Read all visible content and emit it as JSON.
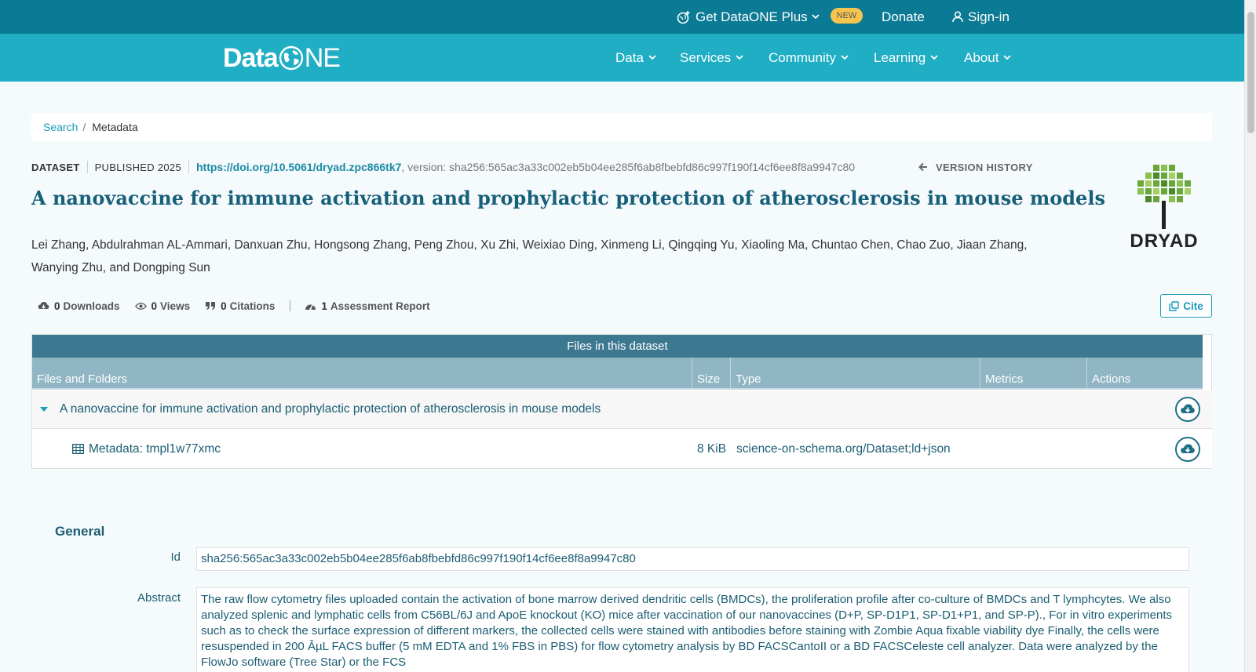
{
  "topbar": {
    "plus_label": "Get DataONE Plus",
    "new_badge": "NEW",
    "donate_label": "Donate",
    "signin_label": "Sign-in"
  },
  "navbar": {
    "logo_text_a": "Data",
    "logo_text_b": "NE",
    "items": [
      "Data",
      "Services",
      "Community",
      "Learning",
      "About"
    ]
  },
  "breadcrumb": {
    "search": "Search",
    "separator": "/",
    "current": "Metadata"
  },
  "dataset": {
    "type": "DATASET",
    "published": "PUBLISHED 2025",
    "doi": "https://doi.org/10.5061/dryad.zpc866tk7",
    "version": ", version: sha256:565ac3a33c002eb5b04ee285f6ab8fbebfd86c997f190f14cf6ee8f8a9947c80",
    "version_history": "VERSION HISTORY",
    "title": "A nanovaccine for immune activation and prophylactic protection of atherosclerosis in mouse models",
    "authors": "Lei Zhang, Abdulrahman AL-Ammari, Danxuan Zhu, Hongsong Zhang, Peng Zhou, Xu Zhi, Weixiao Ding, Xinmeng Li, Qingqing Yu, Xiaoling Ma, Chuntao Chen, Chao Zuo, Jiaan Zhang, Wanying Zhu, and Dongping Sun",
    "repository_logo_text": "DRYAD"
  },
  "stats": {
    "downloads_count": "0",
    "downloads_label": "Downloads",
    "views_count": "0",
    "views_label": "Views",
    "citations_count": "0",
    "citations_label": "Citations",
    "assessment_count": "1",
    "assessment_label": "Assessment Report",
    "cite_label": "Cite"
  },
  "files": {
    "header": "Files in this dataset",
    "columns": [
      "Files and Folders",
      "Size",
      "Type",
      "Metrics",
      "Actions"
    ],
    "rows": [
      {
        "name": "A nanovaccine for immune activation and prophylactic protection of atherosclerosis in mouse models",
        "size": "",
        "type": ""
      },
      {
        "name": "Metadata: tmpl1w77xmc",
        "size": "8 KiB",
        "type": "science-on-schema.org/Dataset;ld+json"
      }
    ]
  },
  "general": {
    "heading": "General",
    "id_label": "Id",
    "id_value": "sha256:565ac3a33c002eb5b04ee285f6ab8fbebfd86c997f190f14cf6ee8f8a9947c80",
    "abstract_label": "Abstract",
    "abstract_value": "The raw flow cytometry files uploaded contain the activation of bone marrow derived dendritic cells (BMDCs), the proliferation profile after co-culture of BMDCs and T lymphcytes. We also analyzed splenic and lymphatic cells from C56BL/6J and ApoE knockout (KO) mice after vaccination of our nanovaccines (D+P, SP-D1P1, SP-D1+P1, and SP-P)., For in vitro experiments such as to check the surface expression of different markers, the collected cells were stained with antibodies before staining with Zombie Aqua fixable viability dye  Finally, the cells were resuspended in 200 ÂµL FACS buffer (5 mM EDTA and 1% FBS in PBS) for flow cytometry analysis by BD FACSCantoII or a BD FACSCeleste cell analyzer. Data were analyzed by the FlowJo software (Tree Star) or the FCS"
  },
  "colors": {
    "topbar": "#0b7a94",
    "navbar": "#20aec5",
    "accent": "#1b9bb5",
    "title": "#16607a",
    "new_badge": "#f6c550"
  }
}
